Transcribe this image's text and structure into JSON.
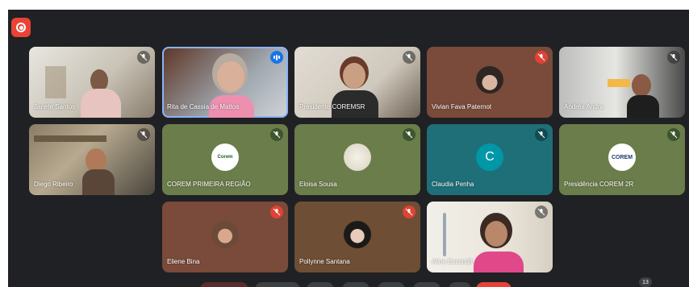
{
  "participants": [
    {
      "name": "Janete Santos"
    },
    {
      "name": "Rita de Cassia de Mattos"
    },
    {
      "name": "Presidente COREMSR"
    },
    {
      "name": "Vivian Fava Paternot"
    },
    {
      "name": "Andréa Andra"
    },
    {
      "name": "Diego Ribeiro"
    },
    {
      "name": "COREM PRIMEIRA REGIÃO"
    },
    {
      "name": "Eloisa Sousa"
    },
    {
      "name": "Claudia Penha",
      "initial": "C"
    },
    {
      "name": "Presidência COREM 2R"
    },
    {
      "name": "Eliene Bina"
    },
    {
      "name": "Pollynne Santana"
    },
    {
      "name": "Aline Escandil"
    }
  ],
  "logos": {
    "corem_1": "Corem",
    "corem_2": "COREM"
  },
  "participant_count": "13",
  "colors": {
    "background": "#202124",
    "speaking": "#1a73e8",
    "muted_red": "#ea4335",
    "avatar_teal": "#0097a7",
    "tile_green": "#6b7d4a",
    "tile_brown": "#7a4a3a"
  }
}
